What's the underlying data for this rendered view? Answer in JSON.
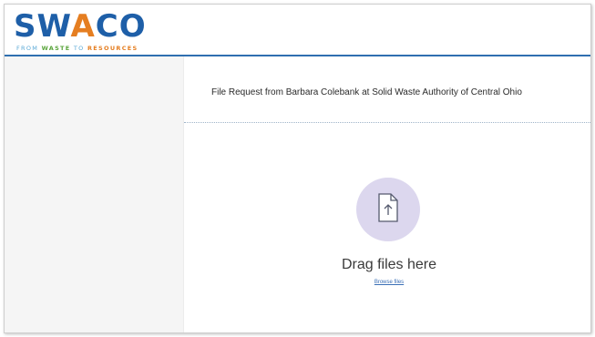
{
  "header": {
    "logo_word_start": "SW",
    "logo_word_accent": "A",
    "logo_word_end": "CO",
    "logo_tagline_from": "FROM",
    "logo_tagline_waste": "WASTE",
    "logo_tagline_to": "TO",
    "logo_tagline_resources": "RESOURCES"
  },
  "main": {
    "request_title": "File Request from Barbara Colebank at Solid Waste Authority of Central Ohio",
    "dropzone": {
      "icon": "file-upload-icon",
      "drag_text": "Drag files here",
      "browse_link": "Browse files"
    }
  },
  "colors": {
    "brand_blue": "#1e5fa8",
    "brand_orange": "#e57e21",
    "brand_green": "#58a43a",
    "upload_circle": "#dcd7ee",
    "link": "#3b6fb6"
  }
}
